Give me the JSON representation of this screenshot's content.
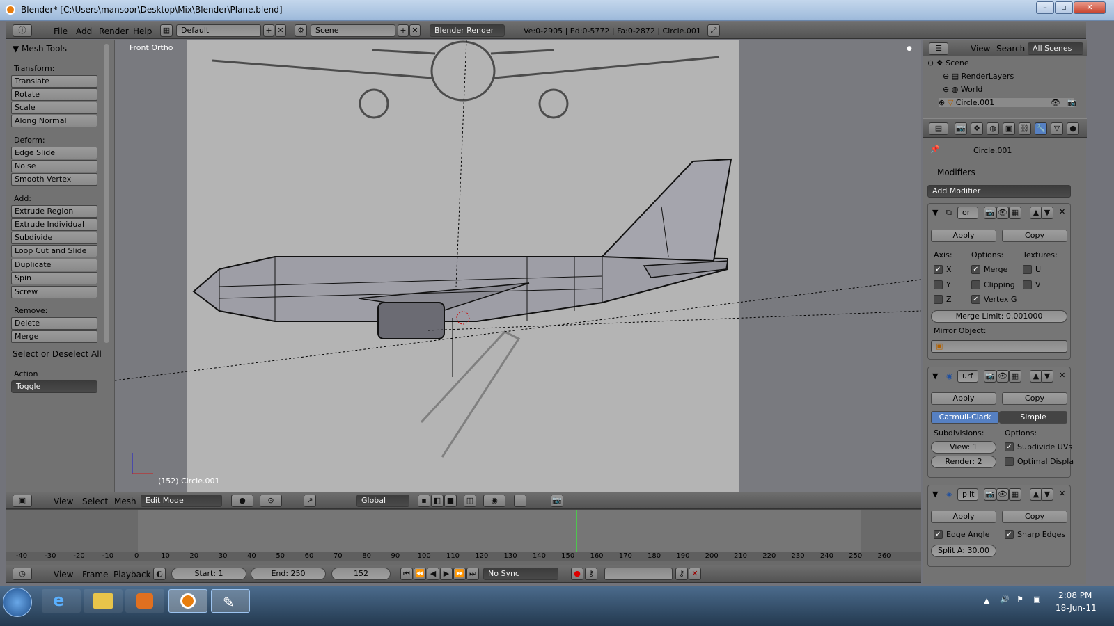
{
  "window": {
    "title": "Blender* [C:\\Users\\mansoor\\Desktop\\Mix\\Blender\\Plane.blend]"
  },
  "info_header": {
    "menus": [
      "File",
      "Add",
      "Render",
      "Help"
    ],
    "layout": "Default",
    "scene": "Scene",
    "engine": "Blender Render",
    "stats": "Ve:0-2905 | Ed:0-5772 | Fa:0-2872 | Circle.001"
  },
  "tool_shelf": {
    "title": "Mesh Tools",
    "transform_label": "Transform:",
    "transform": [
      "Translate",
      "Rotate",
      "Scale",
      "Along Normal"
    ],
    "deform_label": "Deform:",
    "deform": [
      "Edge Slide",
      "Noise",
      "Smooth Vertex"
    ],
    "add_label": "Add:",
    "add": [
      "Extrude Region",
      "Extrude Individual",
      "Subdivide",
      "Loop Cut and Slide",
      "Duplicate",
      "Spin",
      "Screw"
    ],
    "remove_label": "Remove:",
    "remove": [
      "Delete",
      "Merge"
    ],
    "operator_title": "Select or Deselect All",
    "action_label": "Action",
    "action_value": "Toggle"
  },
  "viewport": {
    "view_name": "Front Ortho",
    "object_label": "(152) Circle.001"
  },
  "view3d_header": {
    "menus": [
      "View",
      "Select",
      "Mesh"
    ],
    "mode": "Edit Mode",
    "orientation": "Global"
  },
  "outliner": {
    "menus": [
      "View",
      "Search"
    ],
    "filter": "All Scenes",
    "items": [
      "Scene",
      "RenderLayers",
      "World",
      "Circle.001"
    ]
  },
  "properties": {
    "object_name": "Circle.001",
    "panel_title": "Modifiers",
    "add_modifier": "Add Modifier",
    "apply": "Apply",
    "copy": "Copy",
    "mirror": {
      "name": "or",
      "axis_label": "Axis:",
      "options_label": "Options:",
      "textures_label": "Textures:",
      "x": "X",
      "y": "Y",
      "z": "Z",
      "merge": "Merge",
      "clipping": "Clipping",
      "vertex_groups": "Vertex G",
      "u": "U",
      "v": "V",
      "merge_limit": "Merge Limit: 0.001000",
      "mirror_object_label": "Mirror Object:"
    },
    "subsurf": {
      "name": "urf",
      "catmull": "Catmull-Clark",
      "simple": "Simple",
      "subdivisions_label": "Subdivisions:",
      "options_label": "Options:",
      "view": "View: 1",
      "render": "Render: 2",
      "subdivide_uvs": "Subdivide UVs",
      "optimal_display": "Optimal Displa"
    },
    "edgesplit": {
      "name": "plit",
      "edge_angle": "Edge Angle",
      "sharp_edges": "Sharp Edges",
      "split_angle": "Split A: 30.00"
    }
  },
  "timeline": {
    "ruler_ticks": [
      "-40",
      "-30",
      "-20",
      "-10",
      "0",
      "10",
      "20",
      "30",
      "40",
      "50",
      "60",
      "70",
      "80",
      "90",
      "100",
      "110",
      "120",
      "130",
      "140",
      "150",
      "160",
      "170",
      "180",
      "190",
      "200",
      "210",
      "220",
      "230",
      "240",
      "250",
      "260"
    ],
    "menus": [
      "View",
      "Frame",
      "Playback"
    ],
    "start": "Start: 1",
    "end": "End: 250",
    "current": "152",
    "sync": "No Sync"
  },
  "taskbar": {
    "time": "2:08 PM",
    "date": "18-Jun-11"
  }
}
